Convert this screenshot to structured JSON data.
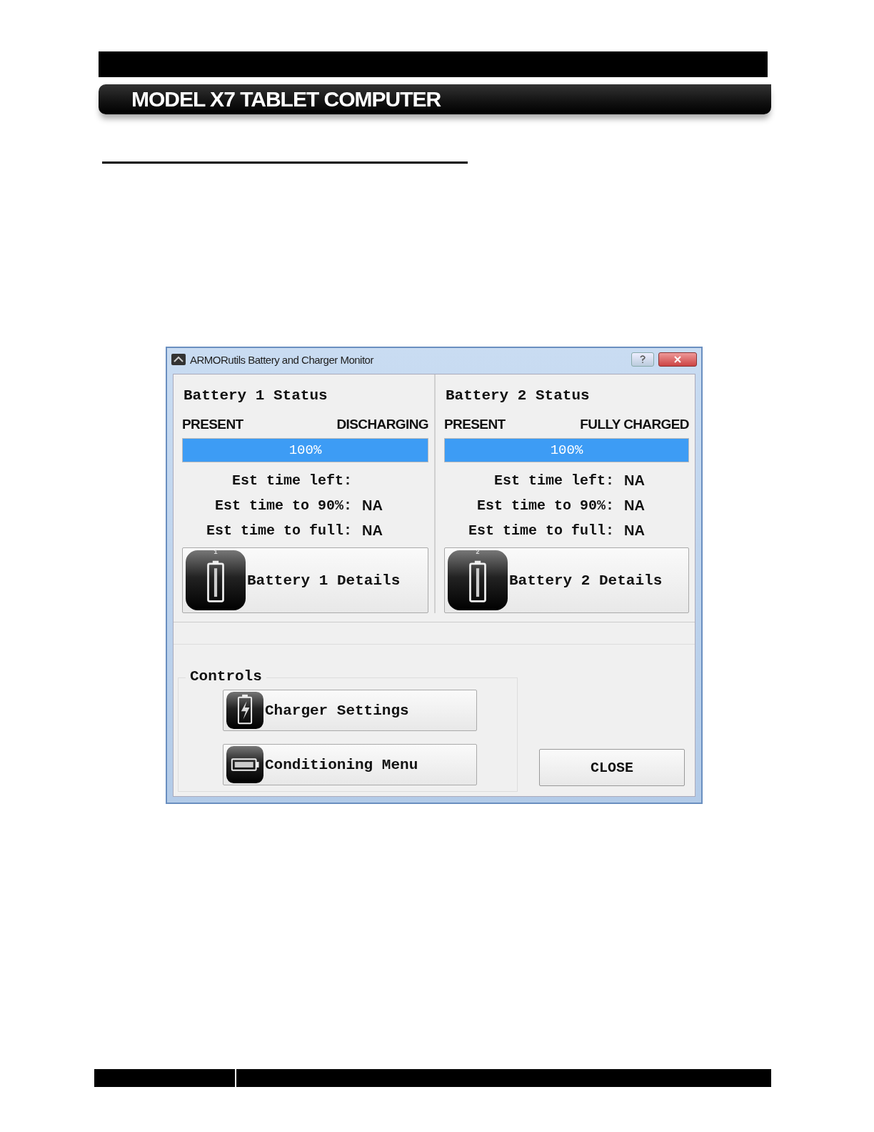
{
  "document": {
    "header_title": "MODEL X7 TABLET COMPUTER"
  },
  "window": {
    "title": "ARMORutils Battery and Charger Monitor"
  },
  "batteries": [
    {
      "title": "Battery 1 Status",
      "presence": "PRESENT",
      "state": "DISCHARGING",
      "level": 1.0,
      "reading": "100%",
      "estimates": [
        {
          "label": "Est time left:"
        },
        {
          "label": "Est time to 90%:",
          "value": "NA"
        },
        {
          "label": "Est time to full:",
          "value": "NA"
        }
      ],
      "details_button": {
        "label": "Battery 1 Details",
        "icon_number": "1"
      }
    },
    {
      "title": "Battery 2 Status",
      "presence": "PRESENT",
      "state": "FULLY CHARGED",
      "level": 1.0,
      "reading": "100%",
      "estimates": [
        {
          "label": "Est time left:",
          "value": "NA"
        },
        {
          "label": "Est time to 90%:",
          "value": "NA"
        },
        {
          "label": "Est time to full:",
          "value": "NA"
        }
      ],
      "details_button": {
        "label": "Battery 2 Details",
        "icon_number": "2"
      }
    }
  ],
  "controls": {
    "title": "Controls",
    "buttons": [
      {
        "label": "Charger Settings",
        "kind": "charger"
      },
      {
        "label": "Conditioning Menu",
        "kind": "conditioning"
      }
    ]
  },
  "close_button": "CLOSE"
}
